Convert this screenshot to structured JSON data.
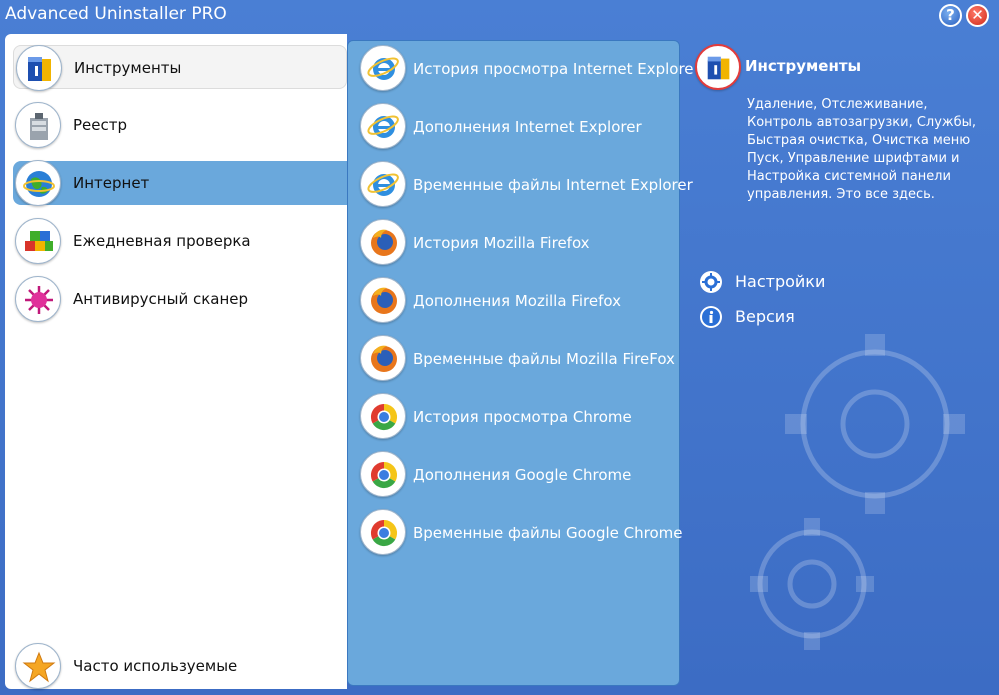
{
  "window": {
    "title": "Advanced Uninstaller PRO",
    "help_label": "?",
    "close_label": "✕"
  },
  "nav": {
    "items": [
      {
        "label": "Инструменты",
        "icon": "tools-icon"
      },
      {
        "label": "Реестр",
        "icon": "registry-icon"
      },
      {
        "label": "Интернет",
        "icon": "internet-globe-icon"
      },
      {
        "label": "Ежедневная проверка",
        "icon": "daily-check-cubes-icon"
      },
      {
        "label": "Антивирусный сканер",
        "icon": "virus-icon"
      }
    ],
    "footer": {
      "label": "Часто используемые",
      "icon": "star-icon"
    },
    "selected": "Интернет"
  },
  "internet_tools": {
    "items": [
      {
        "label": "История просмотра Internet Explore",
        "icon": "internet-explorer-icon"
      },
      {
        "label": "Дополнения Internet Explorer",
        "icon": "internet-explorer-icon"
      },
      {
        "label": "Временные файлы Internet Explorer",
        "icon": "internet-explorer-icon"
      },
      {
        "label": "История Mozilla Firefox",
        "icon": "firefox-icon"
      },
      {
        "label": "Дополнения Mozilla Firefox",
        "icon": "firefox-icon"
      },
      {
        "label": "Временные файлы Mozilla FireFox",
        "icon": "firefox-icon"
      },
      {
        "label": "История просмотра Chrome",
        "icon": "chrome-icon"
      },
      {
        "label": "Дополнения Google Chrome",
        "icon": "chrome-icon"
      },
      {
        "label": "Временные файлы Google Chrome",
        "icon": "chrome-icon"
      }
    ]
  },
  "info": {
    "title": "Инструменты",
    "icon": "tools-icon",
    "description": "Удаление, Отслеживание, Контроль автозагрузки, Службы, Быстрая очистка, Очистка меню Пуск, Управление шрифтами и Настройка системной панели управления. Это все здесь.",
    "links": [
      {
        "label": "Настройки",
        "icon": "settings-icon"
      },
      {
        "label": "Версия",
        "icon": "info-icon"
      }
    ]
  },
  "colors": {
    "window_bg": "#3f72c8",
    "list_bg": "#6aa8dc",
    "accent_red": "#e23c3c"
  }
}
